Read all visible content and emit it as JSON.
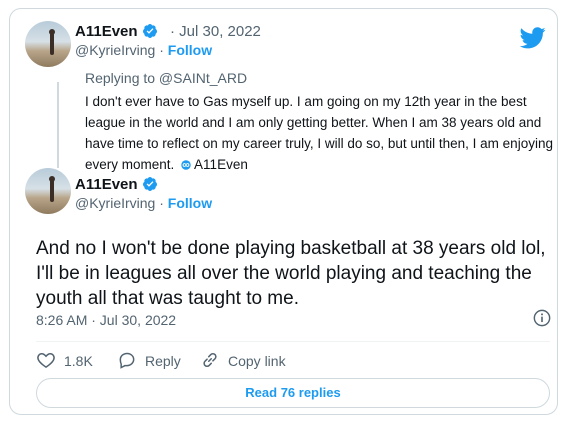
{
  "colors": {
    "brand_blue": "#1d9bf0",
    "text_primary": "#0f1419",
    "text_secondary": "#536471",
    "border": "#cfd9de"
  },
  "quoted_tweet": {
    "name": "A11Even",
    "date": "· Jul 30, 2022",
    "handle": "@KyrieIrving",
    "separator": "·",
    "follow_label": "Follow",
    "replying_to": "Replying to @SAINt_ARD",
    "text": "I don't ever have to Gas myself up. I am going on my 12th year in the best league in the world and I am only getting better. When I am 38 years old and have time to reflect on my career truly, I will do so, but until then, I am enjoying every moment.",
    "signature": "A11Even"
  },
  "main_tweet": {
    "name": "A11Even",
    "handle": "@KyrieIrving",
    "separator": "·",
    "follow_label": "Follow",
    "text": "And no I won't be done playing basketball at 38 years old lol, I'll be in leagues all over the world playing and teaching the youth all that was taught to me.",
    "timestamp": "8:26 AM · Jul 30, 2022"
  },
  "actions": {
    "likes_count": "1.8K",
    "reply_label": "Reply",
    "copy_link_label": "Copy link"
  },
  "read_replies_label": "Read 76 replies",
  "icons": [
    "twitter-logo-icon",
    "verified-badge-icon",
    "infinity-loop-icon",
    "info-icon",
    "heart-icon",
    "reply-bubble-icon",
    "link-icon"
  ]
}
